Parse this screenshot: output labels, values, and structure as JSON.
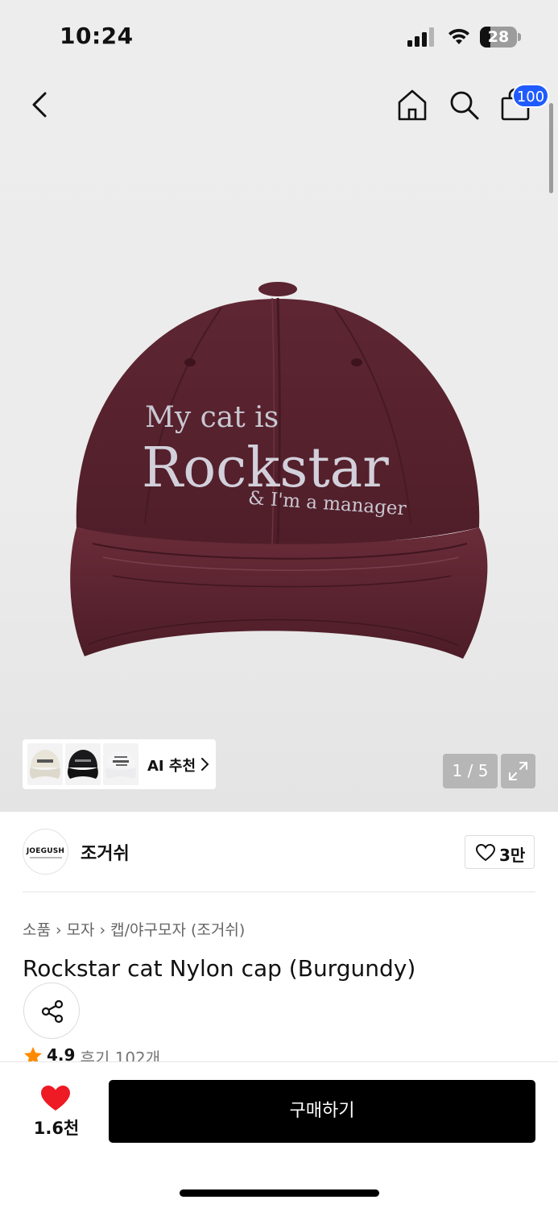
{
  "status_bar": {
    "time": "10:24",
    "battery": "28",
    "battery_level": 0.28
  },
  "header": {
    "icons": [
      "back-icon",
      "home-icon",
      "search-icon",
      "shopping-bag-icon"
    ],
    "cart_badge": "100"
  },
  "gallery": {
    "image_text": {
      "line1": "My cat is",
      "line2": "Rockstar",
      "line3": "& I'm a manager"
    },
    "image_color": "#5a2430",
    "ai_recommend_label": "AI 추천",
    "page_counter": "1 / 5"
  },
  "brand": {
    "logo_text": "JOEGUSH",
    "name": "조거쉬",
    "like_count": "3만"
  },
  "breadcrumb": {
    "items": [
      "소품",
      "모자",
      "캡/야구모자 (조거쉬)"
    ]
  },
  "product": {
    "title": "Rockstar cat Nylon cap (Burgundy)",
    "rating": "4.9",
    "reviews": "후기 102개"
  },
  "bottom_bar": {
    "wish_count": "1.6천",
    "buy_label": "구매하기"
  },
  "colors": {
    "accent_badge": "#1f5bff",
    "heart": "#ee1a24",
    "star": "#ff8a00",
    "buy_button": "#000000"
  }
}
